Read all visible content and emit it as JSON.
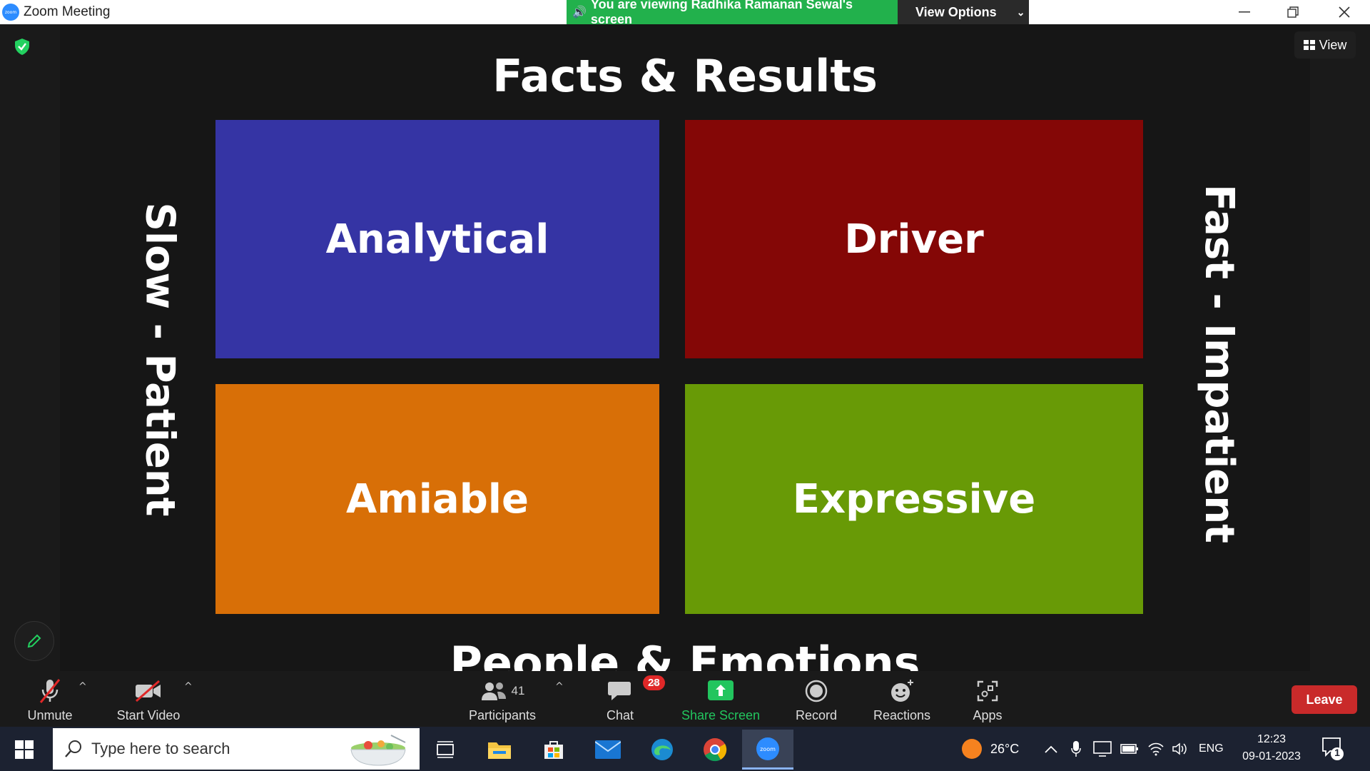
{
  "window": {
    "title": "Zoom Meeting",
    "app_logo_text": "zoom",
    "viewing_banner": "You are viewing Radhika Ramanan Sewal's screen",
    "view_options_label": "View Options",
    "controls": {
      "minimize": "—",
      "restore": "❐",
      "close": "✕"
    }
  },
  "meeting": {
    "view_label": "View",
    "slide": {
      "top_label": "Facts & Results",
      "bottom_label": "People & Emotions",
      "left_label": "Slow - Patient",
      "right_label": "Fast - Impatient",
      "quadrants": [
        {
          "label": "Analytical",
          "color": "#3534a4"
        },
        {
          "label": "Driver",
          "color": "#840706"
        },
        {
          "label": "Amiable",
          "color": "#d86f07"
        },
        {
          "label": "Expressive",
          "color": "#689a06"
        }
      ]
    }
  },
  "toolbar": {
    "unmute": "Unmute",
    "start_video": "Start Video",
    "participants": "Participants",
    "participants_count": "41",
    "chat": "Chat",
    "chat_badge": "28",
    "share_screen": "Share Screen",
    "record": "Record",
    "reactions": "Reactions",
    "apps": "Apps",
    "leave": "Leave",
    "colors": {
      "share_green": "#22c55e",
      "leave_red": "#c92a2a"
    }
  },
  "taskbar": {
    "search_placeholder": "Type here to search",
    "weather_temp": "26°C",
    "language": "ENG",
    "time": "12:23",
    "date": "09-01-2023",
    "notification_count": "1",
    "apps": [
      "task-view",
      "file-explorer",
      "microsoft-store",
      "mail",
      "edge",
      "chrome",
      "zoom"
    ]
  }
}
